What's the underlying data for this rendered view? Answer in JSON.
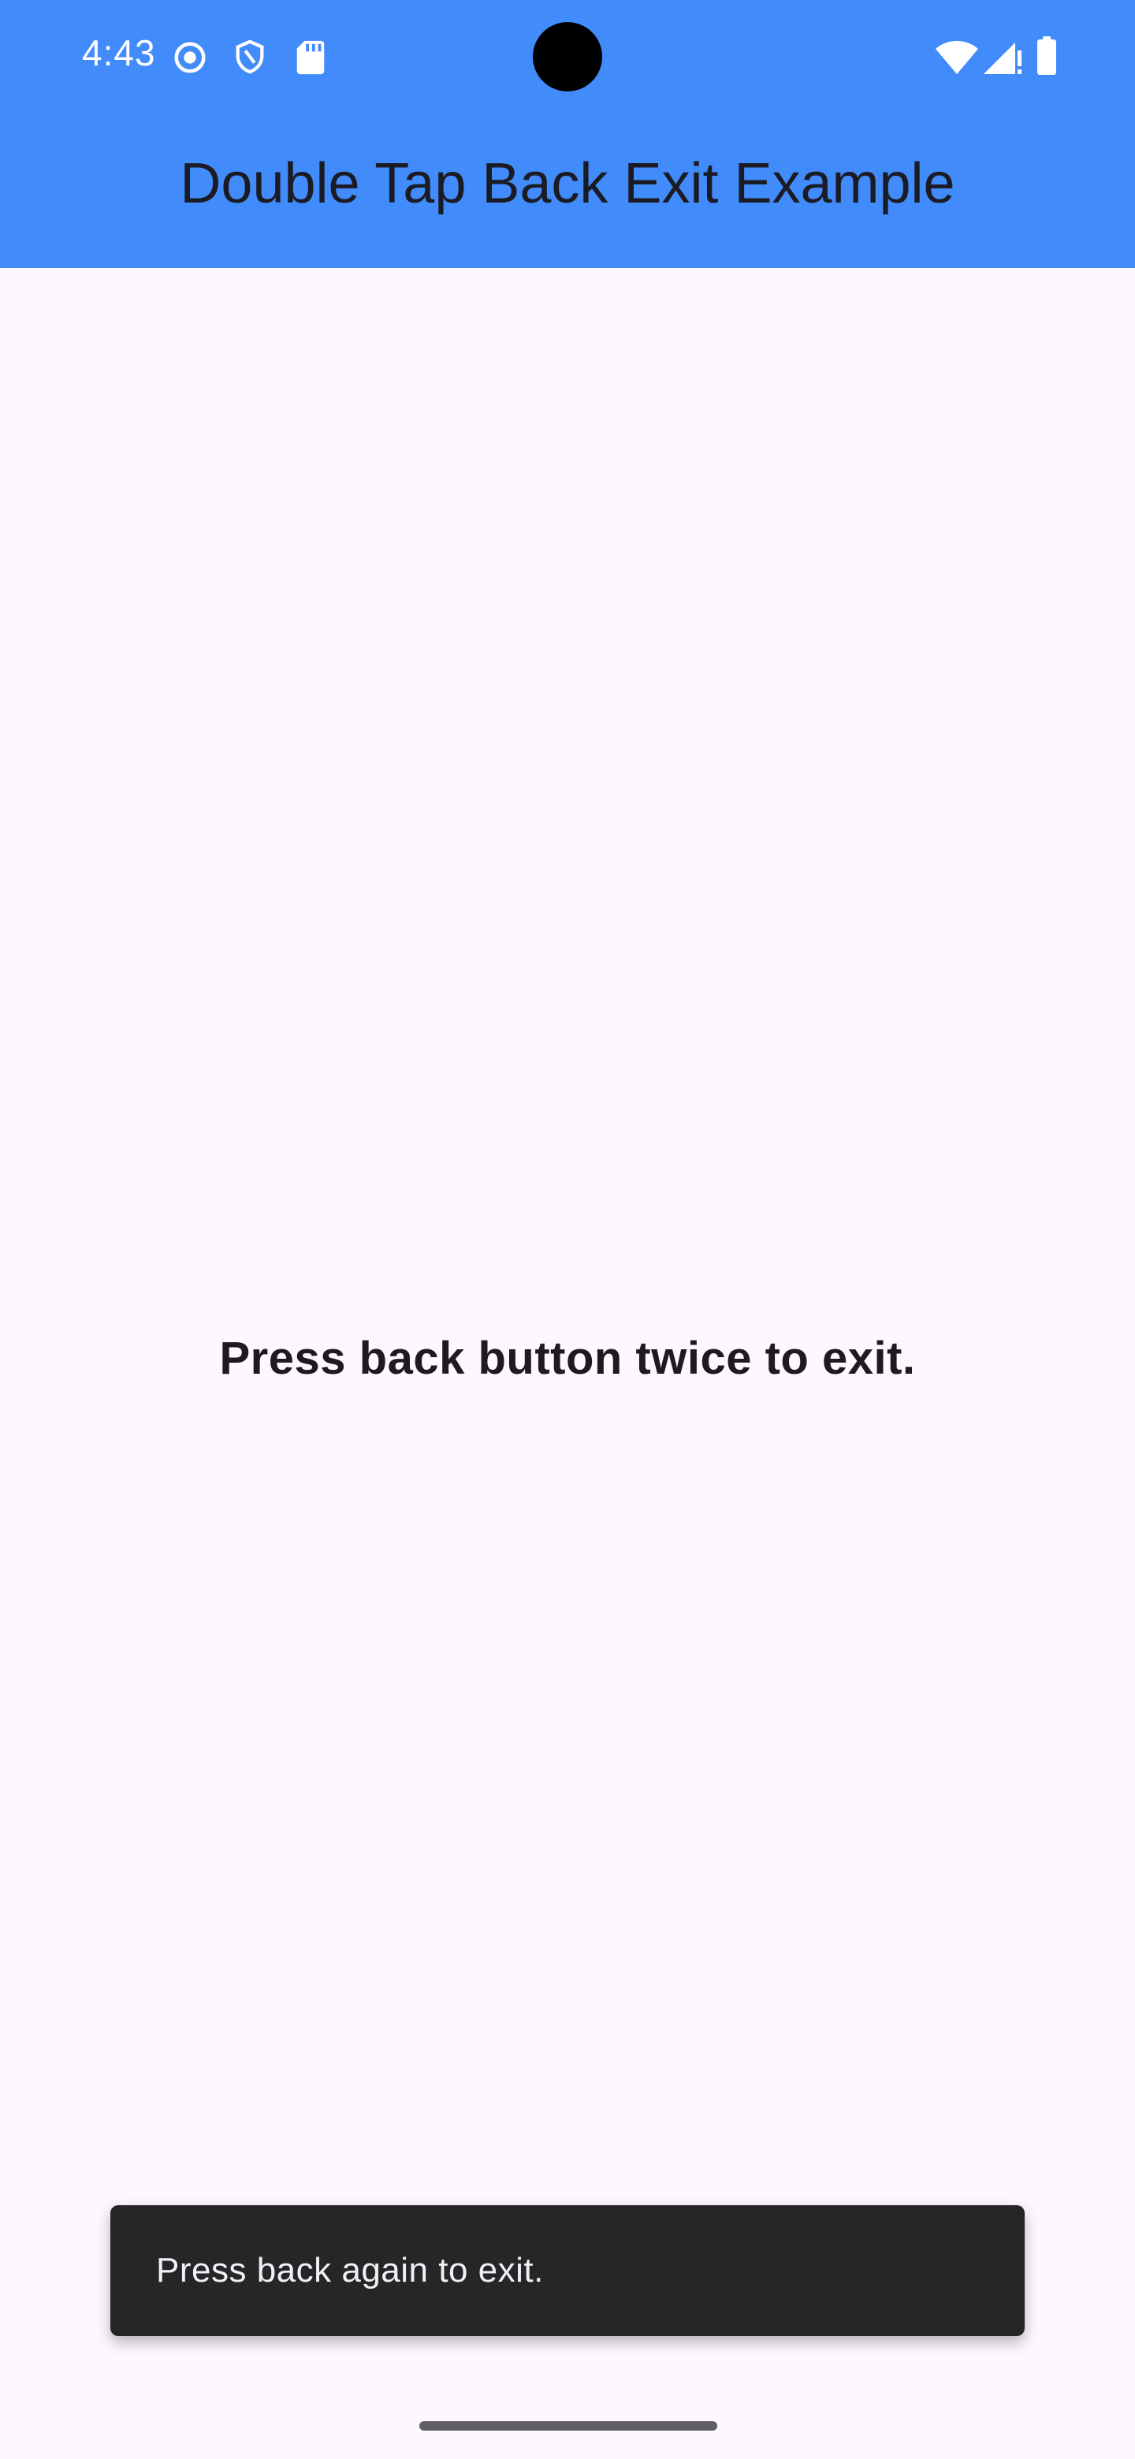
{
  "status_bar": {
    "time": "4:43",
    "left_icons": [
      "screen-record-icon",
      "vpn-shield-icon",
      "sd-card-icon"
    ],
    "right_icons": [
      "wifi-icon",
      "cell-signal-icon",
      "battery-icon"
    ],
    "background": "#428bfb"
  },
  "app_bar": {
    "title": "Double Tap Back Exit Example",
    "background": "#428bfb"
  },
  "main": {
    "message": "Press back button twice to exit."
  },
  "snackbar": {
    "text": "Press back again to exit."
  },
  "colors": {
    "page_background": "#fdf7fe",
    "snackbar_background": "#262527"
  }
}
